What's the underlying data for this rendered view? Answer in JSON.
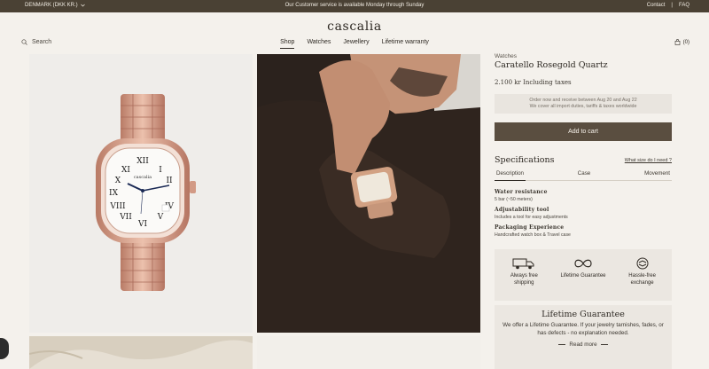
{
  "topbar": {
    "country": "DENMARK (DKK KR.)",
    "announcement": "Our Customer service is available Monday through Sunday",
    "links": [
      "Contact",
      "FAQ"
    ]
  },
  "header": {
    "logo": "cascalia",
    "search_label": "Search",
    "nav": [
      "Shop",
      "Watches",
      "Jewellery",
      "Lifetime warranty"
    ],
    "cart_count": "(0)"
  },
  "product": {
    "category": "Watches",
    "title": "Caratello Rosegold Quartz",
    "price": "2.100 kr Including taxes",
    "delivery_line1": "Order now and receive between Aug 20 and Aug 22",
    "delivery_line2": "We cover all import duties, tariffs & taxes worldwide",
    "add_to_cart": "Add to cart",
    "dial_brand": "cascalia"
  },
  "specifications": {
    "title": "Specifications",
    "size_link": "What size do I need ?",
    "tabs": [
      "Description",
      "Case",
      "Movement"
    ],
    "rows": [
      {
        "label": "Water resistance",
        "value": "5 bar (~50 meters)"
      },
      {
        "label": "Adjustability tool",
        "value": "Includes a tool for easy adjustments"
      },
      {
        "label": "Packaging Experience",
        "value": "Handcrafted watch box & Travel case"
      }
    ]
  },
  "features": [
    {
      "line1": "Always free",
      "line2": "shipping",
      "icon": "truck-icon"
    },
    {
      "line1": "Lifetime Guarantee",
      "line2": "",
      "icon": "infinity-icon"
    },
    {
      "line1": "Hassle-free",
      "line2": "exchange",
      "icon": "exchange-icon"
    }
  ],
  "guarantee": {
    "title": "Lifetime Guarantee",
    "text": "We offer a Lifetime Guarantee. If your jewelry tarnishes, fades, or has defects - no explanation needed.",
    "read_more": "Read more"
  },
  "colors": {
    "topbar": "#4a4134",
    "accent": "#5a4e40",
    "background": "#f4f1ec",
    "rose_gold": "#d9a088"
  }
}
